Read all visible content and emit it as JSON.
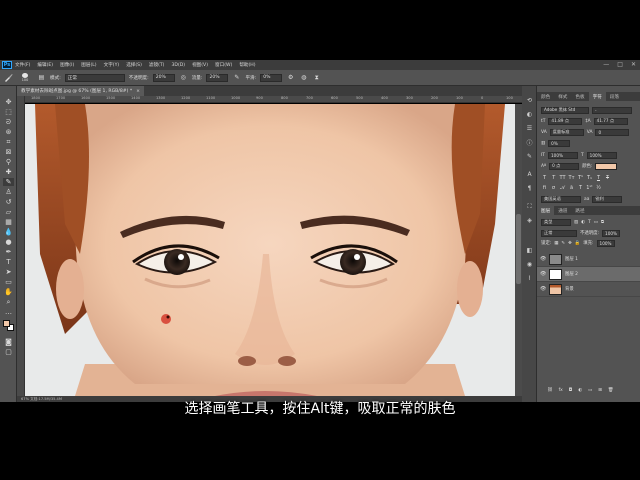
{
  "app": {
    "logo": "Ps",
    "menu": [
      "文件(F)",
      "编辑(E)",
      "图像(I)",
      "图层(L)",
      "文字(Y)",
      "选择(S)",
      "滤镜(T)",
      "3D(D)",
      "视图(V)",
      "窗口(W)",
      "帮助(H)"
    ],
    "window_controls": [
      "—",
      "□",
      "✕"
    ]
  },
  "options": {
    "brush_size": "100",
    "mode_label": "模式:",
    "mode_value": "正常",
    "opacity_label": "不透明度:",
    "opacity_value": "20%",
    "flow_label": "流量:",
    "flow_value": "20%",
    "smooth_label": "平滑:",
    "smooth_value": "0%"
  },
  "document": {
    "tab_title": "教学素材去除斑点图.jpg @ 67% (图层 1, RGB/8#) *",
    "close": "×",
    "ruler_labels": [
      "1800",
      "1700",
      "1600",
      "1500",
      "1400",
      "1300",
      "1200",
      "1100",
      "1000",
      "900",
      "800",
      "700",
      "600",
      "500",
      "400",
      "300",
      "200",
      "100",
      "0",
      "100"
    ],
    "status": "67%    文档:17.5M/35.4M"
  },
  "panels": {
    "top_tabs": [
      "颜色",
      "样式",
      "色板",
      "字符",
      "段落"
    ],
    "character": {
      "font_family": "Adobe 黑体 Std",
      "font_style": "-",
      "font_size": "41.89 点",
      "leading": "41.77 点",
      "kerning": "度量标准",
      "tracking": "0",
      "scale_v": "100%",
      "scale_h": "100%",
      "baseline": "0 点",
      "color_label": "颜色:",
      "color_value": "#f2c8a9",
      "language": "美国英语",
      "aa_label": "aa",
      "aa_value": "锐利"
    },
    "layers_tabs": [
      "图层",
      "通道",
      "路径"
    ],
    "layers": {
      "filter_label": "类型",
      "blend_mode": "正常",
      "opacity_label": "不透明度:",
      "opacity_value": "100%",
      "lock_label": "锁定:",
      "fill_label": "填充:",
      "fill_value": "100%",
      "items": [
        {
          "name": "图层 1",
          "visible": true,
          "selected": false
        },
        {
          "name": "图层 2",
          "visible": true,
          "selected": true
        },
        {
          "name": "背景",
          "visible": true,
          "selected": false
        }
      ]
    }
  },
  "subtitle": "选择画笔工具，按住Alt键，吸取正常的肤色"
}
